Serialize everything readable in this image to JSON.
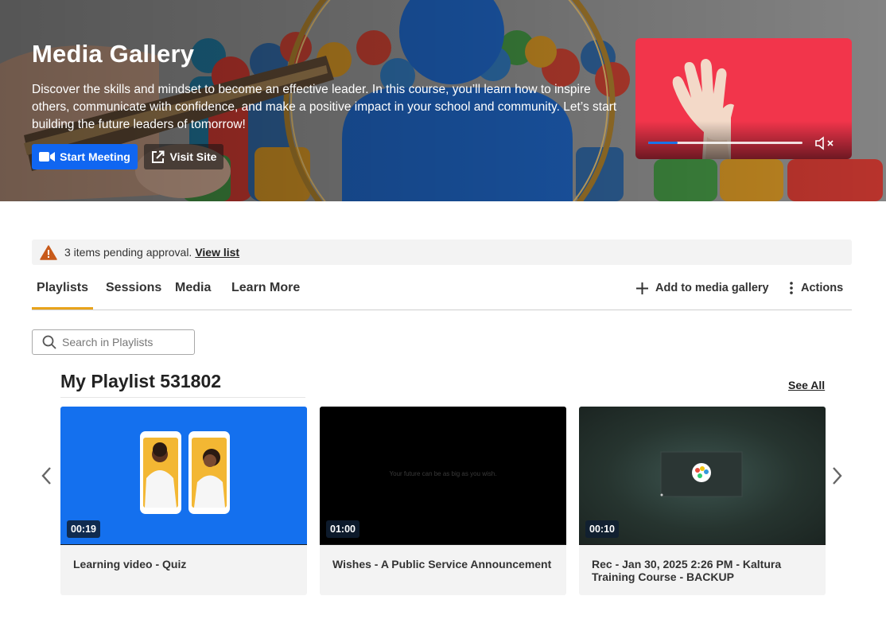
{
  "hero": {
    "title": "Media Gallery",
    "description": "Discover the skills and mindset to become an effective leader. In this course, you’ll learn how to inspire others, communicate with confidence, and make a positive impact in your school and community. Let’s start building the future leaders of tomorrow!",
    "start_meeting_label": "Start Meeting",
    "visit_site_label": "Visit Site",
    "player": {
      "progress": 0.19,
      "accent_color": "#1a73e8",
      "background_color": "#f2354b",
      "icon": "volume-muted-icon"
    }
  },
  "alert": {
    "message": "3 items pending approval.",
    "link_label": "View list",
    "icon": "warning-icon",
    "icon_color": "#c85a1a"
  },
  "tabs": {
    "items": [
      {
        "label": "Playlists",
        "active": true
      },
      {
        "label": "Sessions",
        "active": false
      },
      {
        "label": "Media",
        "active": false
      },
      {
        "label": "Learn More",
        "active": false
      }
    ],
    "add_label": "Add to media gallery",
    "actions_label": "Actions",
    "active_color": "#e8a31b"
  },
  "search": {
    "placeholder": "Search in Playlists",
    "value": ""
  },
  "playlist": {
    "title": "My Playlist 531802",
    "see_all_label": "See All",
    "items": [
      {
        "title": "Learning video - Quiz",
        "duration": "00:19"
      },
      {
        "title": "Wishes - A Public Service Announcement",
        "duration": "01:00",
        "thumb_text": "Your future can be as big as you wish."
      },
      {
        "title": "Rec - Jan 30, 2025 2:26 PM - Kaltura Training Course - BACKUP",
        "duration": "00:10"
      }
    ]
  },
  "colors": {
    "primary": "#1066f1",
    "text": "#222222"
  }
}
